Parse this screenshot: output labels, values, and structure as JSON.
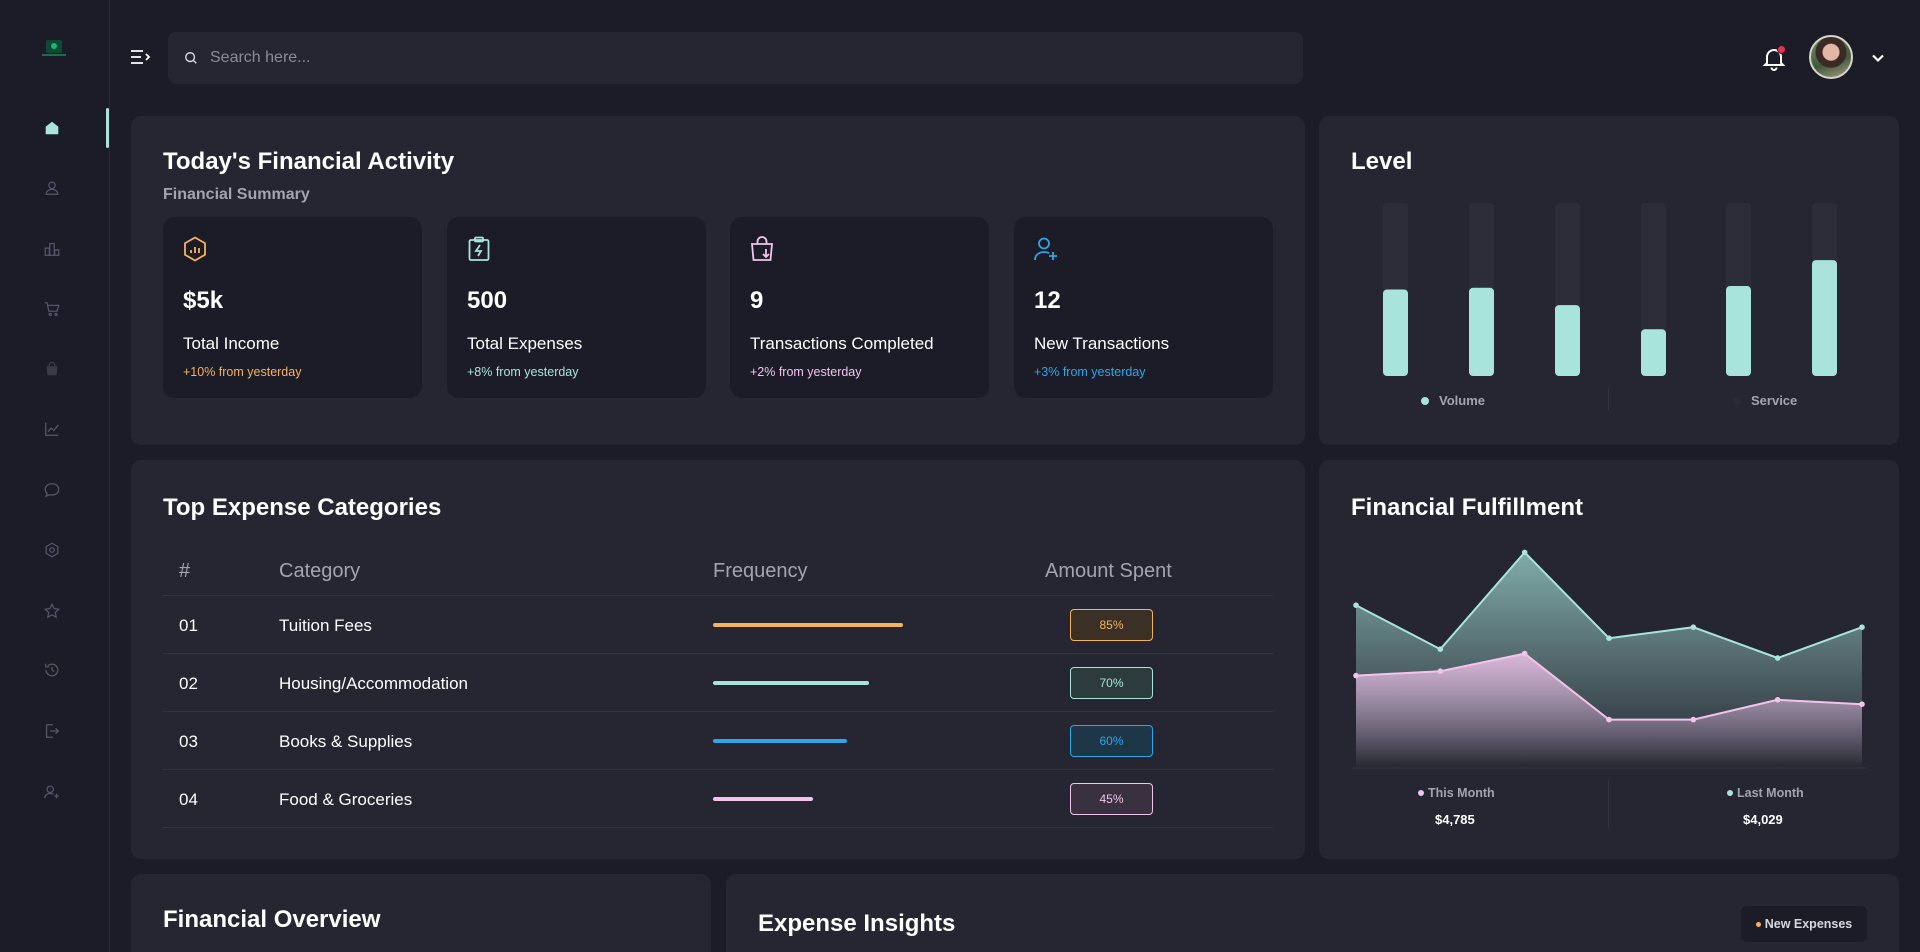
{
  "colors": {
    "background": "#1b1c27",
    "card": "#252632",
    "accent_teal": "#a8e4dc",
    "orange": "#f5b35b",
    "sky": "#2ea6e8",
    "pink": "#f2c3ec",
    "muted": "#a3a4ae"
  },
  "sidebar": {
    "items": [
      {
        "icon": "home-icon",
        "active": true
      },
      {
        "icon": "user-icon"
      },
      {
        "icon": "leaderboard-icon"
      },
      {
        "icon": "cart-icon"
      },
      {
        "icon": "shopping-bag-icon"
      },
      {
        "icon": "line-chart-icon"
      },
      {
        "icon": "message-icon"
      },
      {
        "icon": "settings-icon"
      },
      {
        "icon": "star-icon"
      },
      {
        "icon": "history-icon"
      },
      {
        "icon": "sign-in-icon"
      },
      {
        "icon": "add-user-icon"
      }
    ]
  },
  "topbar": {
    "search_placeholder": "Search here...",
    "notification_unread": true
  },
  "activity": {
    "title": "Today's Financial Activity",
    "subtitle": "Financial Summary",
    "stats": [
      {
        "icon": "chart-hexagon-icon",
        "value": "$5k",
        "label": "Total Income",
        "change": "+10% from yesterday",
        "color": "#f5b35b"
      },
      {
        "icon": "clipboard-bolt-icon",
        "value": "500",
        "label": "Total Expenses",
        "change": "+8% from yesterday",
        "color": "#a8e4dc"
      },
      {
        "icon": "bag-download-icon",
        "value": "9",
        "label": "Transactions Completed",
        "change": "+2% from yesterday",
        "color": "#f2c3ec"
      },
      {
        "icon": "user-plus-icon",
        "value": "12",
        "label": "New Transactions",
        "change": "+3% from yesterday",
        "color": "#2ea6e8"
      }
    ]
  },
  "level": {
    "title": "Level",
    "bars": [
      0.5,
      0.51,
      0.41,
      0.27,
      0.52,
      0.67
    ],
    "legend": [
      {
        "label": "Volume",
        "color": "#a8e4dc"
      },
      {
        "label": "Service",
        "color": "#2a2b36"
      }
    ]
  },
  "expenses": {
    "title": "Top Expense Categories",
    "headers": {
      "num": "#",
      "category": "Category",
      "frequency": "Frequency",
      "amount": "Amount Spent"
    },
    "rows": [
      {
        "num": "01",
        "category": "Tuition Fees",
        "pct": "85%",
        "frequency": 0.85,
        "color": "#f5b35b",
        "bg": "#3a3026"
      },
      {
        "num": "02",
        "category": "Housing/Accommodation",
        "pct": "70%",
        "frequency": 0.7,
        "color": "#a8e4dc",
        "bg": "#2c3b3c"
      },
      {
        "num": "03",
        "category": "Books & Supplies",
        "pct": "60%",
        "frequency": 0.6,
        "color": "#2ea6e8",
        "bg": "#1e3748"
      },
      {
        "num": "04",
        "category": "Food & Groceries",
        "pct": "45%",
        "frequency": 0.45,
        "color": "#f2c3ec",
        "bg": "#3a3140"
      }
    ]
  },
  "fulfillment": {
    "title": "Financial Fulfillment",
    "legend": [
      {
        "label": "This Month",
        "amount": "$4,785",
        "color": "#f2c3ec"
      },
      {
        "label": "Last Month",
        "amount": "$4,029",
        "color": "#a8e4dc"
      }
    ]
  },
  "chart_data": {
    "type": "area",
    "title": "Financial Fulfillment",
    "x": [
      1,
      2,
      3,
      4,
      5,
      6,
      7
    ],
    "series": [
      {
        "name": "Last Month",
        "values": [
          0.74,
          0.54,
          0.98,
          0.59,
          0.64,
          0.5,
          0.64
        ]
      },
      {
        "name": "This Month",
        "values": [
          0.42,
          0.44,
          0.52,
          0.22,
          0.22,
          0.31,
          0.29
        ]
      }
    ],
    "ylim": [
      0,
      1
    ],
    "grid": false
  },
  "overview": {
    "title": "Financial Overview"
  },
  "insights": {
    "title": "Expense Insights",
    "chip_label": "New Expenses",
    "chip_color": "#f5b35b"
  }
}
